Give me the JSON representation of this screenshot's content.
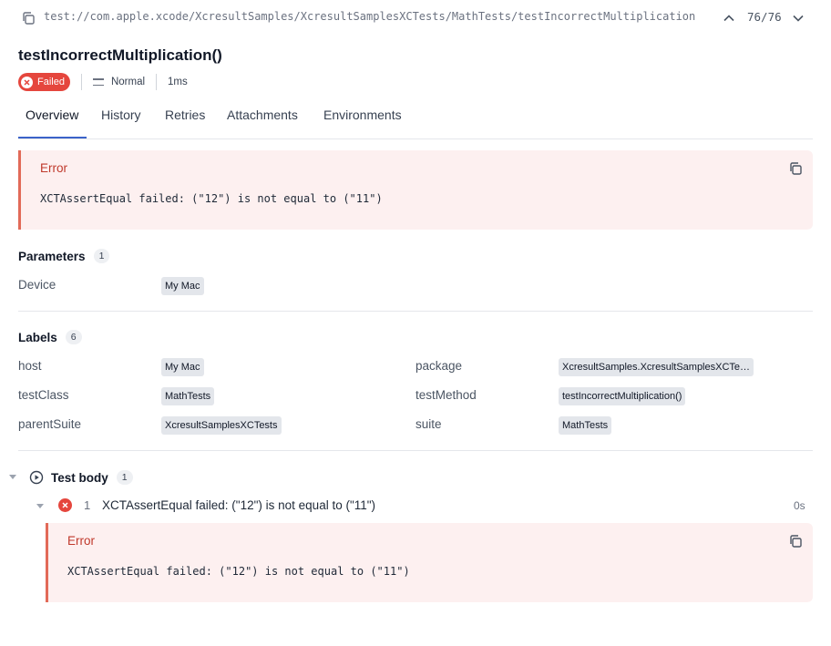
{
  "topbar": {
    "path": "test://com.apple.xcode/XcresultSamples/XcresultSamplesXCTests/MathTests/testIncorrectMultiplication",
    "counter": "76/76"
  },
  "test": {
    "title": "testIncorrectMultiplication()",
    "status": "Failed",
    "severity": "Normal",
    "duration": "1ms"
  },
  "tabs": [
    "Overview",
    "History",
    "Retries",
    "Attachments",
    "Environments"
  ],
  "error": {
    "title": "Error",
    "message": "XCTAssertEqual failed: (\"12\") is not equal to (\"11\")"
  },
  "parameters": {
    "title": "Parameters",
    "count": "1",
    "items": [
      {
        "key": "Device",
        "value": "My Mac"
      }
    ]
  },
  "labels": {
    "title": "Labels",
    "count": "6",
    "items": [
      {
        "key": "host",
        "value": "My Mac"
      },
      {
        "key": "package",
        "value": "XcresultSamples.XcresultSamplesXCTe…"
      },
      {
        "key": "testClass",
        "value": "MathTests"
      },
      {
        "key": "testMethod",
        "value": "testIncorrectMultiplication()"
      },
      {
        "key": "parentSuite",
        "value": "XcresultSamplesXCTests"
      },
      {
        "key": "suite",
        "value": "MathTests"
      }
    ]
  },
  "test_body": {
    "title": "Test body",
    "count": "1",
    "steps": [
      {
        "number": "1",
        "text": "XCTAssertEqual failed: (\"12\") is not equal to (\"11\")",
        "duration": "0s",
        "error_title": "Error",
        "error_message": "XCTAssertEqual failed: (\"12\") is not equal to (\"11\")"
      }
    ]
  },
  "colors": {
    "failed": "#e5463d",
    "error_text": "#c0392b",
    "error_bg": "#fdf0f0",
    "error_border": "#e26a58",
    "tab_accent": "#3b63c9"
  }
}
